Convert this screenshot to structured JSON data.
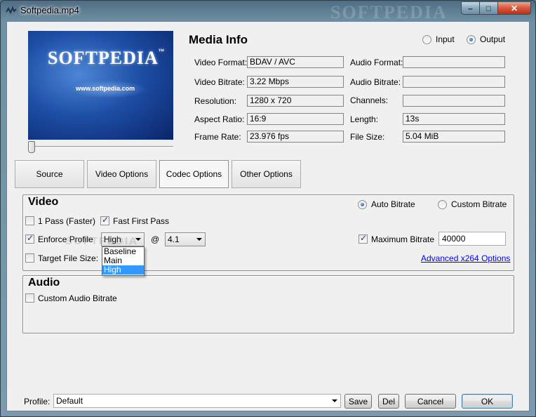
{
  "window": {
    "title": "Softpedia.mp4",
    "watermark": "SOFTPEDIA",
    "minimize": "–",
    "maximize": "□",
    "close": "✕"
  },
  "preview": {
    "brand": "SOFTPEDIA",
    "tm": "™",
    "url": "www.softpedia.com",
    "seek_position": 0
  },
  "media_info": {
    "title": "Media Info",
    "source_options": [
      {
        "label": "Input",
        "checked": false
      },
      {
        "label": "Output",
        "checked": true
      }
    ],
    "left_fields": [
      {
        "label": "Video Format:",
        "value": "BDAV / AVC"
      },
      {
        "label": "Video Bitrate:",
        "value": "3.22 Mbps"
      },
      {
        "label": "Resolution:",
        "value": "1280 x 720"
      },
      {
        "label": "Aspect Ratio:",
        "value": "16:9"
      },
      {
        "label": "Frame Rate:",
        "value": "23.976 fps"
      }
    ],
    "right_fields": [
      {
        "label": "Audio Format:",
        "value": ""
      },
      {
        "label": "Audio Bitrate:",
        "value": ""
      },
      {
        "label": "Channels:",
        "value": ""
      },
      {
        "label": "Length:",
        "value": "13s"
      },
      {
        "label": "File Size:",
        "value": "5.04 MiB"
      }
    ]
  },
  "tabs": [
    {
      "label": "Source",
      "active": false
    },
    {
      "label": "Video Options",
      "active": false
    },
    {
      "label": "Codec Options",
      "active": true
    },
    {
      "label": "Other Options",
      "active": false
    }
  ],
  "video": {
    "title": "Video",
    "auto_bitrate": "Auto Bitrate",
    "custom_bitrate": "Custom Bitrate",
    "one_pass": "1 Pass (Faster)",
    "fast_first_pass": "Fast First Pass",
    "enforce_profile": "Enforce Profile",
    "profile_value": "High",
    "at_sign": "@",
    "level_value": "4.1",
    "profile_options": [
      "Baseline",
      "Main",
      "High"
    ],
    "target_file_size": "Target File Size:",
    "maximum_bitrate": "Maximum Bitrate",
    "maximum_bitrate_value": "40000",
    "advanced_link": "Advanced x264 Options"
  },
  "audio": {
    "title": "Audio",
    "custom_audio_bitrate": "Custom Audio Bitrate"
  },
  "footer": {
    "profile_label": "Profile:",
    "profile_value": "Default",
    "save": "Save",
    "del": "Del",
    "cancel": "Cancel",
    "ok": "OK"
  },
  "overlay_watermark": "SOFTPEDIA"
}
